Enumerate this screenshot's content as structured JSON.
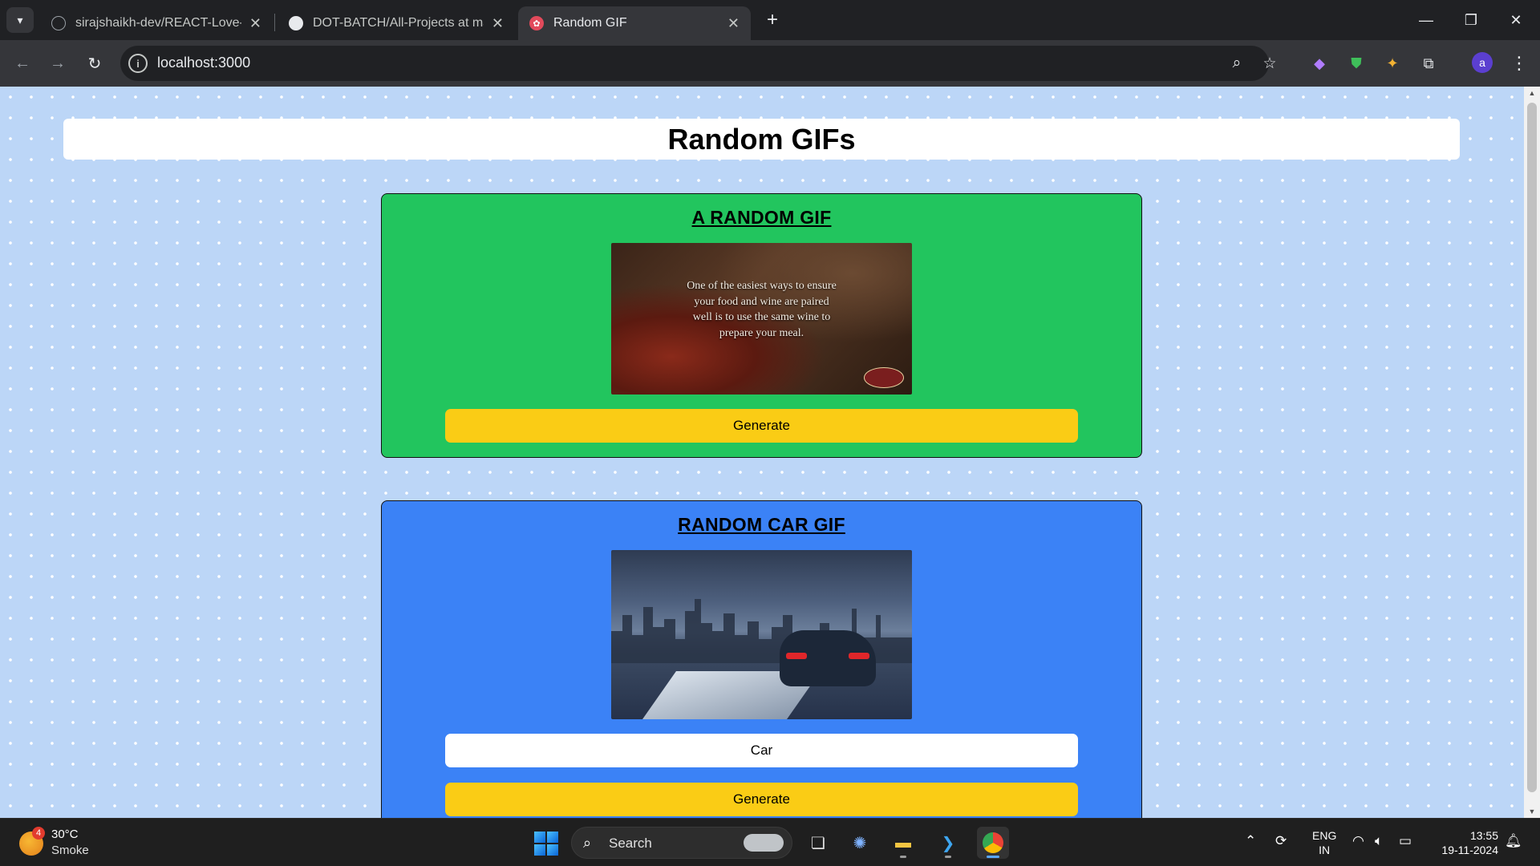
{
  "browser": {
    "tabs": [
      {
        "title": "sirajshaikh-dev/REACT-Love-Ba",
        "favicon": "github-icon"
      },
      {
        "title": "DOT-BATCH/All-Projects at mas",
        "favicon": "github-icon"
      },
      {
        "title": "Random GIF",
        "favicon": "react-app-icon",
        "active": true
      }
    ],
    "url": "localhost:3000",
    "profile_initial": "a"
  },
  "page": {
    "title": "Random GIFs",
    "random_card": {
      "title": "A RANDOM GIF",
      "image_caption": "One of the easiest ways to ensure your food and wine are paired well is to use the same wine to prepare your meal.",
      "button_label": "Generate"
    },
    "tag_card": {
      "title": "RANDOM CAR GIF",
      "input_value": "Car",
      "button_label": "Generate"
    },
    "colors": {
      "background": "#bcd6f7",
      "random_card": "#22c55e",
      "tag_card": "#3b82f6",
      "button": "#facc15"
    }
  },
  "taskbar": {
    "weather_badge": "4",
    "weather_temp": "30°C",
    "weather_desc": "Smoke",
    "search_label": "Search",
    "lang_line1": "ENG",
    "lang_line2": "IN",
    "time": "13:55",
    "date": "19-11-2024"
  }
}
